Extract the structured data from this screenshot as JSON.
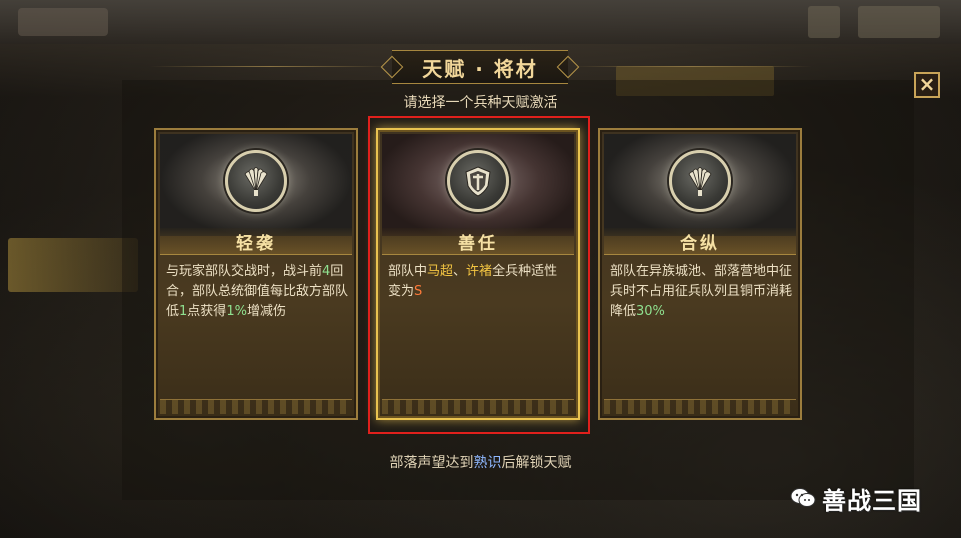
{
  "title": "天赋 · 将材",
  "subtitle": "请选择一个兵种天赋激活",
  "close_label": "×",
  "cards": [
    {
      "name": "轻袭",
      "emblem_icon": "feather-fan-icon",
      "selected": false,
      "desc_parts": [
        {
          "t": "与玩家部队交战时，战斗前",
          "c": ""
        },
        {
          "t": "4",
          "c": "hl-green"
        },
        {
          "t": "回合，部队总统御值每比敌方部队低",
          "c": ""
        },
        {
          "t": "1",
          "c": "hl-green"
        },
        {
          "t": "点获得",
          "c": ""
        },
        {
          "t": "1%",
          "c": "hl-green"
        },
        {
          "t": "增减伤",
          "c": ""
        }
      ]
    },
    {
      "name": "善任",
      "emblem_icon": "shield-icon",
      "selected": true,
      "desc_parts": [
        {
          "t": "部队中",
          "c": ""
        },
        {
          "t": "马超",
          "c": "hl-gold"
        },
        {
          "t": "、",
          "c": "sep"
        },
        {
          "t": "许褚",
          "c": "hl-gold"
        },
        {
          "t": "全兵种适性变为",
          "c": ""
        },
        {
          "t": "S",
          "c": "hl-orange"
        }
      ]
    },
    {
      "name": "合纵",
      "emblem_icon": "feather-fan-icon",
      "selected": false,
      "desc_parts": [
        {
          "t": "部队在异族城池、部落营地中征兵时不占用征兵队列且铜币消耗降低",
          "c": ""
        },
        {
          "t": "30%",
          "c": "hl-green"
        }
      ]
    }
  ],
  "footer_parts": [
    {
      "t": "部落声望达到",
      "c": ""
    },
    {
      "t": "熟识",
      "c": "hl-blue"
    },
    {
      "t": "后解锁天赋",
      "c": ""
    }
  ],
  "watermark": "善战三国",
  "colors": {
    "gold": "#f2d79a",
    "frame_red": "#e0201c",
    "highlight_green": "#8fe08f"
  }
}
